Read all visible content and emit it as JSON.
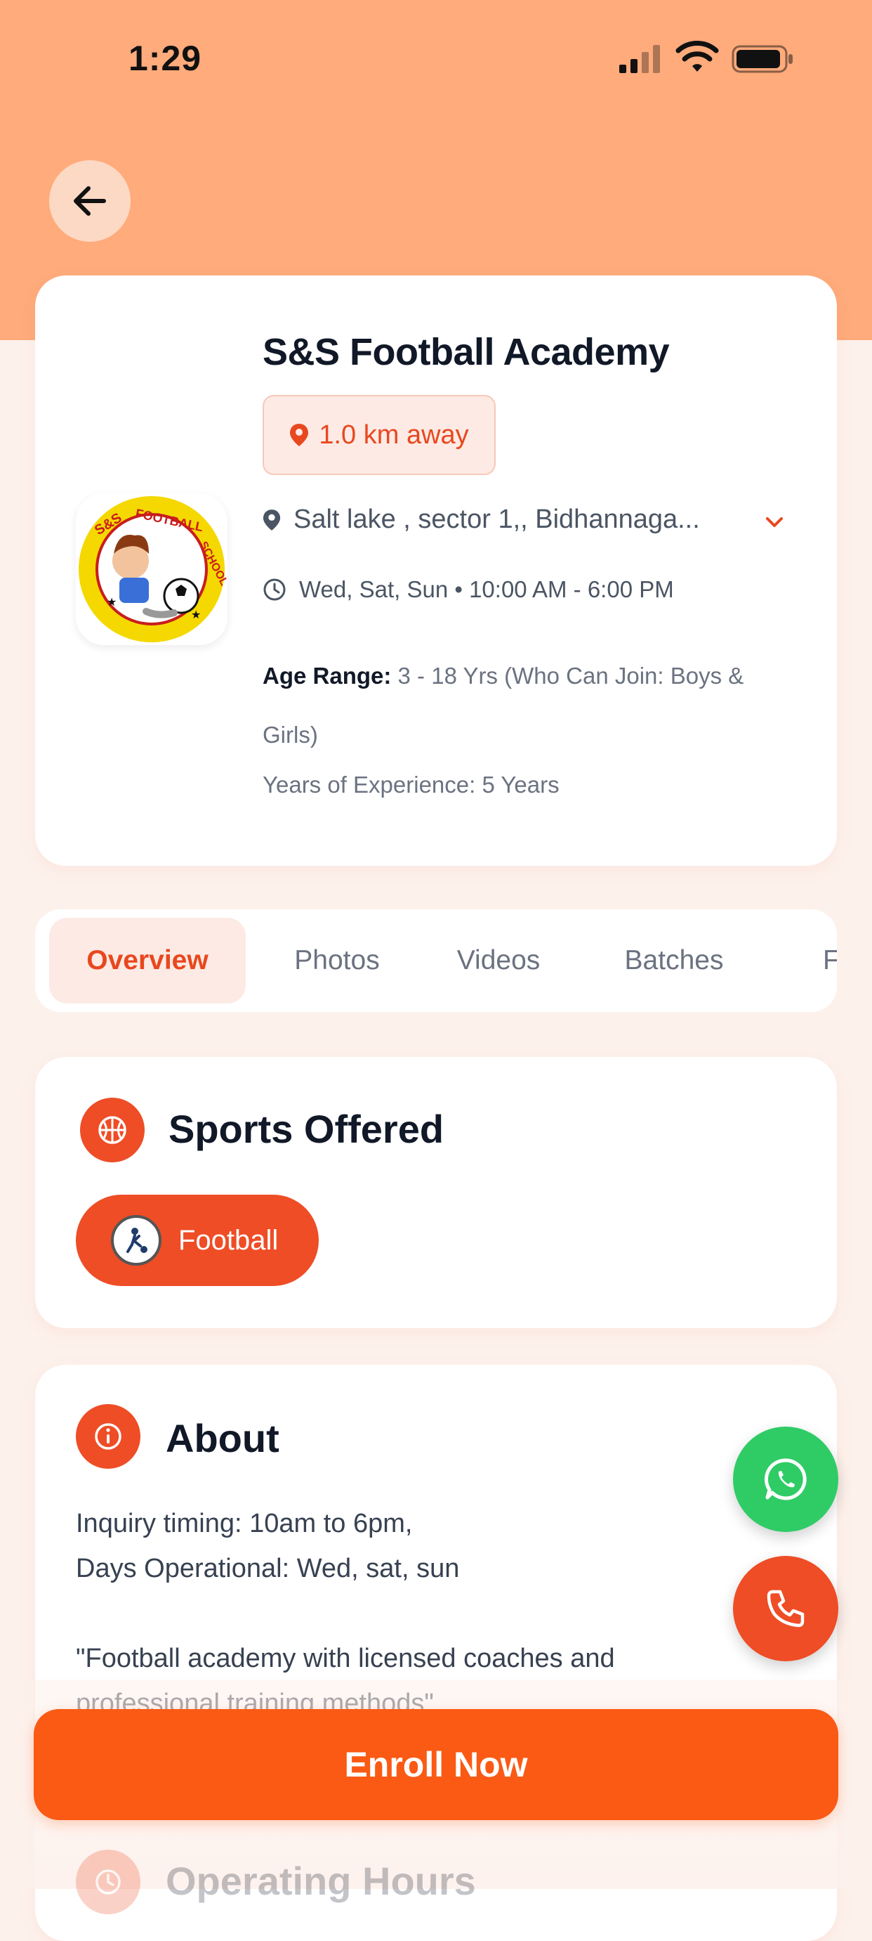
{
  "status_bar": {
    "time": "1:29"
  },
  "academy": {
    "name": "S&S Football Academy",
    "distance": "1.0 km away",
    "address": "Salt lake , sector 1,, Bidhannaga...",
    "schedule": "Wed, Sat, Sun • 10:00 AM - 6:00 PM",
    "age_range_label": "Age Range:",
    "age_range_value": "3 - 18 Yrs (Who Can Join: Boys & Girls)",
    "experience": "Years of Experience: 5 Years",
    "logo_text": "S&S FOOTBALL SCHOOL"
  },
  "tabs": [
    {
      "label": "Overview",
      "active": true
    },
    {
      "label": "Photos",
      "active": false
    },
    {
      "label": "Videos",
      "active": false
    },
    {
      "label": "Batches",
      "active": false
    },
    {
      "label": "F",
      "active": false
    }
  ],
  "sports": {
    "title": "Sports Offered",
    "items": [
      {
        "label": "Football"
      }
    ]
  },
  "about": {
    "title": "About",
    "text": "Inquiry timing: 10am to 6pm,\nDays Operational: Wed, sat, sun\n\n\"Football academy with licensed coaches and\nprofessional training methods\""
  },
  "operating_hours": {
    "title": "Operating Hours"
  },
  "enroll": {
    "label": "Enroll Now"
  },
  "icons": {
    "back": "arrow-left-icon",
    "distance": "map-pin-icon",
    "address": "map-pin-icon",
    "schedule": "clock-icon",
    "sports": "basketball-icon",
    "about": "info-icon",
    "whatsapp": "whatsapp-icon",
    "call": "phone-icon"
  },
  "colors": {
    "header": "#ffab7b",
    "background": "#fdf1ec",
    "accent": "#ee4d26",
    "enroll": "#fa5a14",
    "whatsapp": "#2fcc66"
  }
}
